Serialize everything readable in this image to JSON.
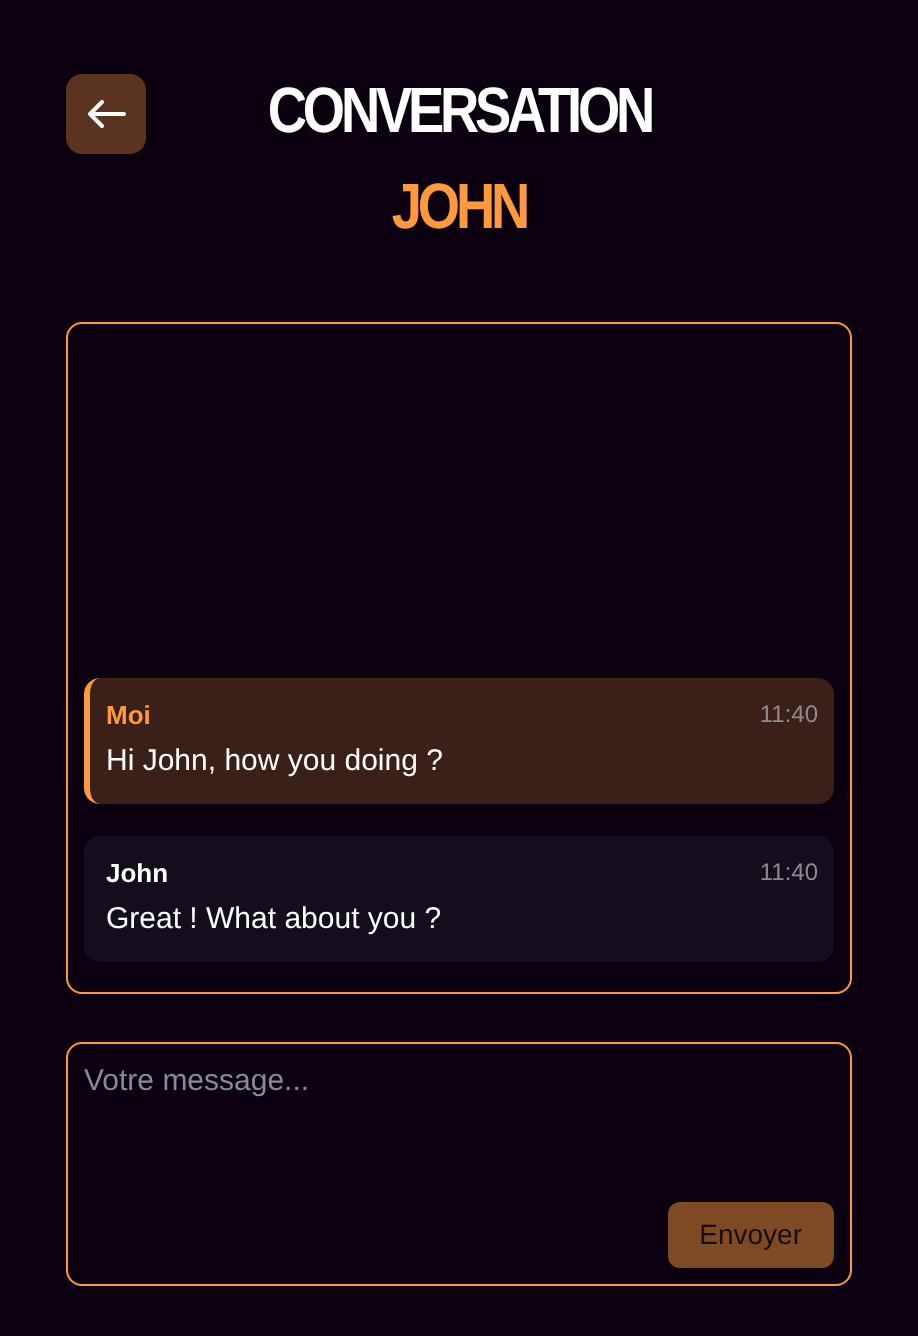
{
  "header": {
    "title": "CONVERSATION",
    "contact": "JOHN"
  },
  "messages": [
    {
      "kind": "own",
      "author": "Moi",
      "time": "11:40",
      "text": "Hi John, how you doing ?"
    },
    {
      "kind": "other",
      "author": "John",
      "time": "11:40",
      "text": "Great ! What about you ?"
    }
  ],
  "composer": {
    "placeholder": "Votre message...",
    "send": "Envoyer"
  }
}
